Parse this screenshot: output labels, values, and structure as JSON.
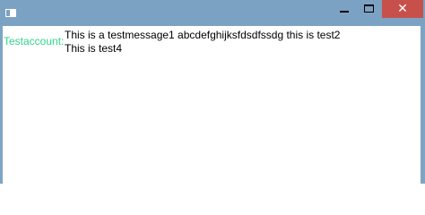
{
  "window": {
    "controls": {
      "close_glyph": "✕"
    }
  },
  "chat": {
    "account_label": "Testaccount:",
    "messages": [
      "This is a testmessage1 abcdefghijksfdsdfssdg this is test2",
      "This is test4"
    ]
  },
  "colors": {
    "titlebar": "#7ba2c3",
    "close_button": "#c7504b",
    "account_text": "#2fd68a"
  }
}
